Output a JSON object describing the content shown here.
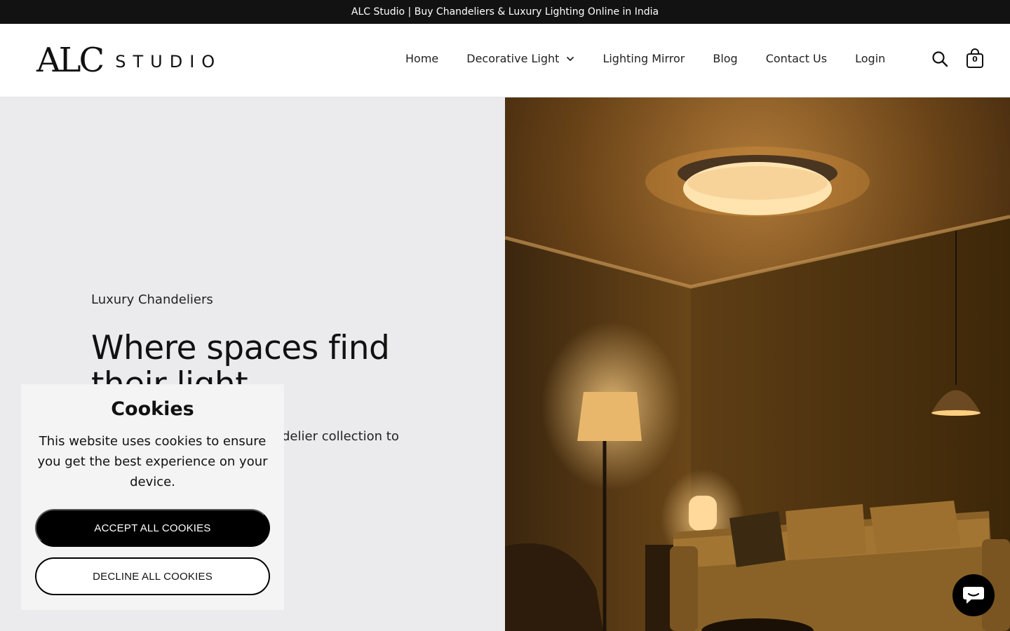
{
  "announcement": "ALC Studio | Buy Chandeliers & Luxury Lighting Online in India",
  "logo": {
    "mark": "ALC",
    "word": "STUDIO"
  },
  "nav": {
    "home": "Home",
    "decorative": "Decorative Light",
    "mirror": "Lighting Mirror",
    "blog": "Blog",
    "contact": "Contact Us",
    "login": "Login"
  },
  "cart": {
    "count": "0"
  },
  "hero": {
    "eyebrow": "Luxury Chandeliers",
    "title": "Where spaces find their light",
    "text_visible_fragment": "delier collection to"
  },
  "cookie": {
    "title": "Cookies",
    "text": "This website uses cookies to ensure you get the best experience on your device.",
    "accept": "ACCEPT ALL COOKIES",
    "decline": "DECLINE ALL COOKIES"
  },
  "icons": {
    "search": "search-icon",
    "cart": "shopping-bag-icon",
    "chevron": "chevron-down-icon",
    "chat": "chat-icon"
  },
  "colors": {
    "announcement_bg": "#121212",
    "hero_left_bg": "#ebebee",
    "button_primary": "#000000",
    "cookie_bg": "#f4f4f4"
  }
}
